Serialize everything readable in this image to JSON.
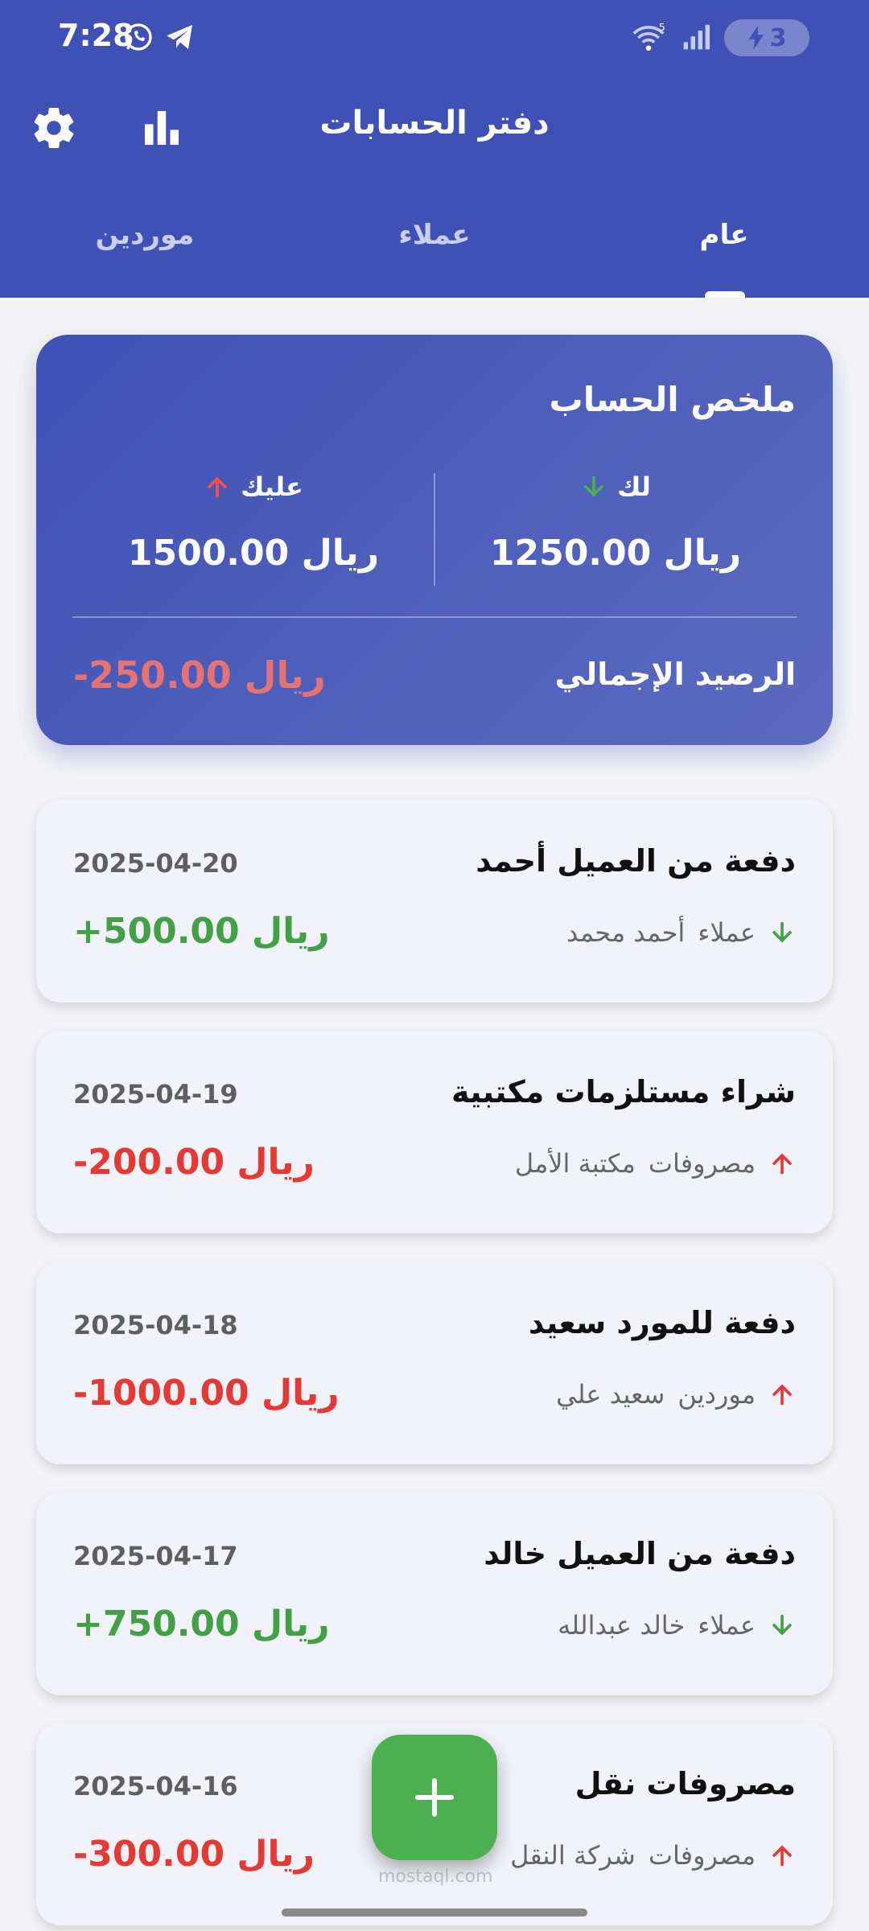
{
  "status_bar": {
    "time": "7:28",
    "battery_level": "3",
    "network": "5"
  },
  "toolbar": {
    "title": "دفتر الحسابات"
  },
  "tabs": [
    {
      "label": "موردين",
      "active": false
    },
    {
      "label": "عملاء",
      "active": false
    },
    {
      "label": "عام",
      "active": true
    }
  ],
  "summary": {
    "title": "ملخص الحساب",
    "incoming_label": "لك",
    "incoming_amount": "1250.00 ريال",
    "outgoing_label": "عليك",
    "outgoing_amount": "1500.00 ريال",
    "total_label": "الرصيد الإجمالي",
    "total_amount": "-250.00 ريال"
  },
  "transactions": [
    {
      "title": "دفعة من العميل أحمد",
      "date": "2025-04-20",
      "category": "عملاء",
      "party": "أحمد محمد",
      "amount": "+500.00 ريال",
      "direction": "in"
    },
    {
      "title": "شراء مستلزمات مكتبية",
      "date": "2025-04-19",
      "category": "مصروفات",
      "party": "مكتبة الأمل",
      "amount": "-200.00 ريال",
      "direction": "out"
    },
    {
      "title": "دفعة للمورد سعيد",
      "date": "2025-04-18",
      "category": "موردين",
      "party": "سعيد علي",
      "amount": "-1000.00 ريال",
      "direction": "out"
    },
    {
      "title": "دفعة من العميل خالد",
      "date": "2025-04-17",
      "category": "عملاء",
      "party": "خالد عبدالله",
      "amount": "+750.00 ريال",
      "direction": "in"
    },
    {
      "title": "مصروفات نقل",
      "date": "2025-04-16",
      "category": "مصروفات",
      "party": "شركة النقل",
      "amount": "-300.00 ريال",
      "direction": "out"
    }
  ],
  "colors": {
    "primary": "#3f51b5",
    "positive": "#43a047",
    "negative": "#e53935",
    "fab": "#4caf50"
  },
  "watermark": "mostaql.com"
}
